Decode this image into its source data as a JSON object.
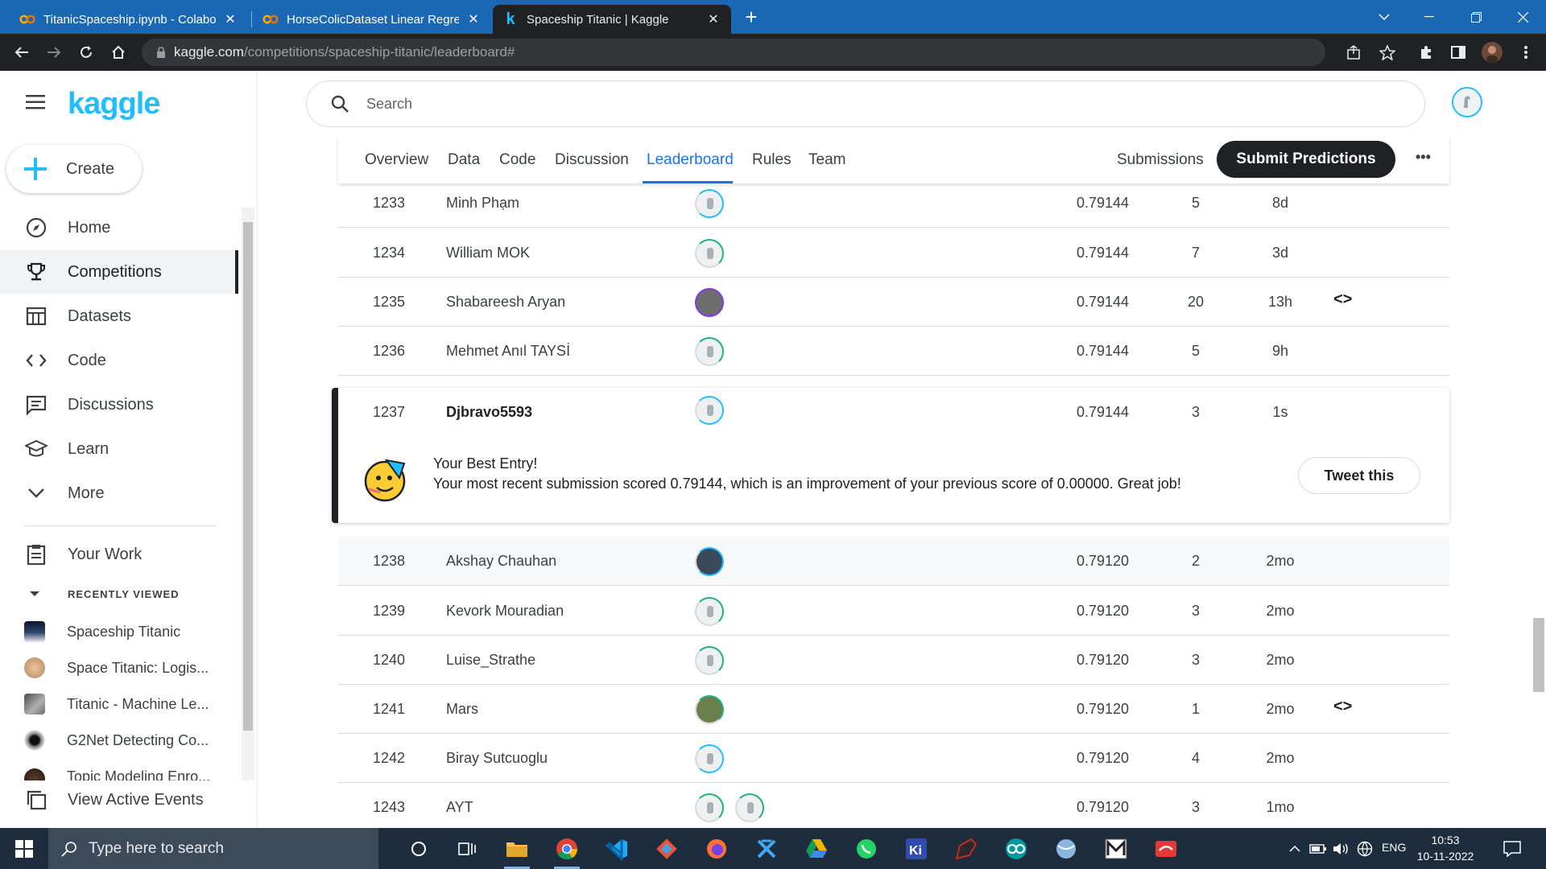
{
  "browser": {
    "tabs": [
      {
        "title": "TitanicSpaceship.ipynb - Colabor",
        "icon": "colab-icon"
      },
      {
        "title": "HorseColicDataset Linear Regress",
        "icon": "colab-icon"
      },
      {
        "title": "Spaceship Titanic | Kaggle",
        "icon": "kaggle-icon",
        "active": true
      }
    ],
    "url_host": "kaggle.com",
    "url_path": "/competitions/spaceship-titanic/leaderboard#"
  },
  "sidebar": {
    "logo": "kaggle",
    "create_label": "Create",
    "nav": [
      {
        "label": "Home",
        "icon": "compass-icon"
      },
      {
        "label": "Competitions",
        "icon": "trophy-icon",
        "selected": true
      },
      {
        "label": "Datasets",
        "icon": "table-icon"
      },
      {
        "label": "Code",
        "icon": "code-icon"
      },
      {
        "label": "Discussions",
        "icon": "discussion-icon"
      },
      {
        "label": "Learn",
        "icon": "graduation-cap-icon"
      },
      {
        "label": "More",
        "icon": "chevron-down-icon"
      }
    ],
    "your_work": "Your Work",
    "recently_viewed_heading": "RECENTLY VIEWED",
    "recent": [
      {
        "label": "Spaceship Titanic"
      },
      {
        "label": "Space Titanic: Logis..."
      },
      {
        "label": "Titanic - Machine Le..."
      },
      {
        "label": "G2Net Detecting Co..."
      },
      {
        "label": "Topic Modeling Enro..."
      }
    ],
    "view_active_events": "View Active Events"
  },
  "search": {
    "placeholder": "Search"
  },
  "competition_tabs": [
    "Overview",
    "Data",
    "Code",
    "Discussion",
    "Leaderboard",
    "Rules",
    "Team"
  ],
  "active_tab": "Leaderboard",
  "submissions_label": "Submissions",
  "submit_label": "Submit Predictions",
  "more_label": "•••",
  "rows_above": [
    {
      "rank": "1233",
      "name": "Minh Phạm",
      "score": "0.79144",
      "entries": "5",
      "last": "8d",
      "code": false
    },
    {
      "rank": "1234",
      "name": "William MOK",
      "score": "0.79144",
      "entries": "7",
      "last": "3d",
      "code": false
    },
    {
      "rank": "1235",
      "name": "Shabareesh Aryan",
      "score": "0.79144",
      "entries": "20",
      "last": "13h",
      "code": true
    },
    {
      "rank": "1236",
      "name": "Mehmet Anıl TAYSİ",
      "score": "0.79144",
      "entries": "5",
      "last": "9h",
      "code": false
    }
  ],
  "best": {
    "rank": "1237",
    "name": "Djbravo5593",
    "score": "0.79144",
    "entries": "3",
    "last": "1s",
    "title": "Your Best Entry!",
    "message": "Your most recent submission scored 0.79144, which is an improvement of your previous score of 0.00000. Great job!",
    "tweet_label": "Tweet this"
  },
  "rows_below": [
    {
      "rank": "1238",
      "name": "Akshay Chauhan",
      "score": "0.79120",
      "entries": "2",
      "last": "2mo",
      "code": false
    },
    {
      "rank": "1239",
      "name": "Kevork Mouradian",
      "score": "0.79120",
      "entries": "3",
      "last": "2mo",
      "code": false
    },
    {
      "rank": "1240",
      "name": "Luise_Strathe",
      "score": "0.79120",
      "entries": "3",
      "last": "2mo",
      "code": false
    },
    {
      "rank": "1241",
      "name": "Mars",
      "score": "0.79120",
      "entries": "1",
      "last": "2mo",
      "code": true
    },
    {
      "rank": "1242",
      "name": "Biray Sutcuoglu",
      "score": "0.79120",
      "entries": "4",
      "last": "2mo",
      "code": false
    },
    {
      "rank": "1243",
      "name": "AYT",
      "score": "0.79120",
      "entries": "3",
      "last": "1mo",
      "code": false
    }
  ],
  "code_glyph": "<>",
  "taskbar": {
    "search_placeholder": "Type here to search",
    "lang": "ENG",
    "time": "10:53",
    "date": "10-11-2022"
  },
  "colors": {
    "kaggle_blue": "#20beff",
    "tab_active": "#1a73e8",
    "dark": "#202124"
  }
}
